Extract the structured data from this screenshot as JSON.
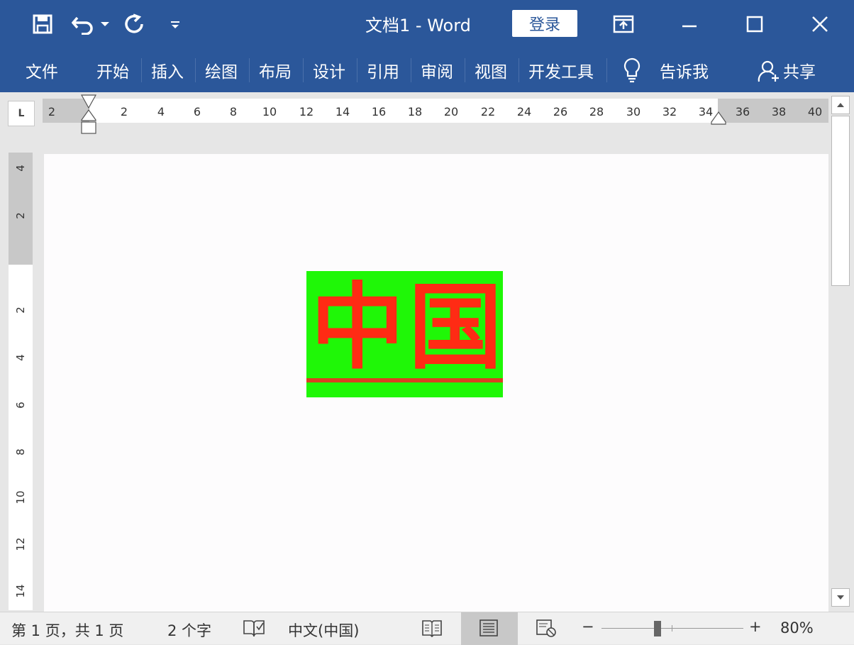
{
  "titlebar": {
    "title": "文档1  -  Word",
    "login_label": "登录",
    "icons": [
      "save-icon",
      "undo-icon",
      "undo-dropdown-icon",
      "redo-icon",
      "customize-qat-icon",
      "ribbon-display-icon",
      "minimize-icon",
      "maximize-icon",
      "close-icon"
    ]
  },
  "ribbon": {
    "tabs": [
      {
        "label": "文件"
      },
      {
        "label": "开始"
      },
      {
        "label": "插入"
      },
      {
        "label": "绘图"
      },
      {
        "label": "布局"
      },
      {
        "label": "设计"
      },
      {
        "label": "引用"
      },
      {
        "label": "审阅"
      },
      {
        "label": "视图"
      },
      {
        "label": "开发工具"
      }
    ],
    "tell_me": "告诉我",
    "share": "共享"
  },
  "ruler": {
    "corner": "L",
    "h_ticks": [
      "2",
      "2",
      "4",
      "6",
      "8",
      "10",
      "12",
      "14",
      "16",
      "18",
      "20",
      "22",
      "24",
      "26",
      "28",
      "30",
      "32",
      "34",
      "36",
      "38",
      "40"
    ],
    "v_ticks": [
      "4",
      "2",
      "2",
      "4",
      "6",
      "8",
      "10",
      "12",
      "14"
    ]
  },
  "document": {
    "text": "中国"
  },
  "statusbar": {
    "page": "第 1 页，共 1 页",
    "words": "2 个字",
    "language": "中文(中国)",
    "zoom_minus": "−",
    "zoom_plus": "+",
    "zoom": "80%"
  }
}
